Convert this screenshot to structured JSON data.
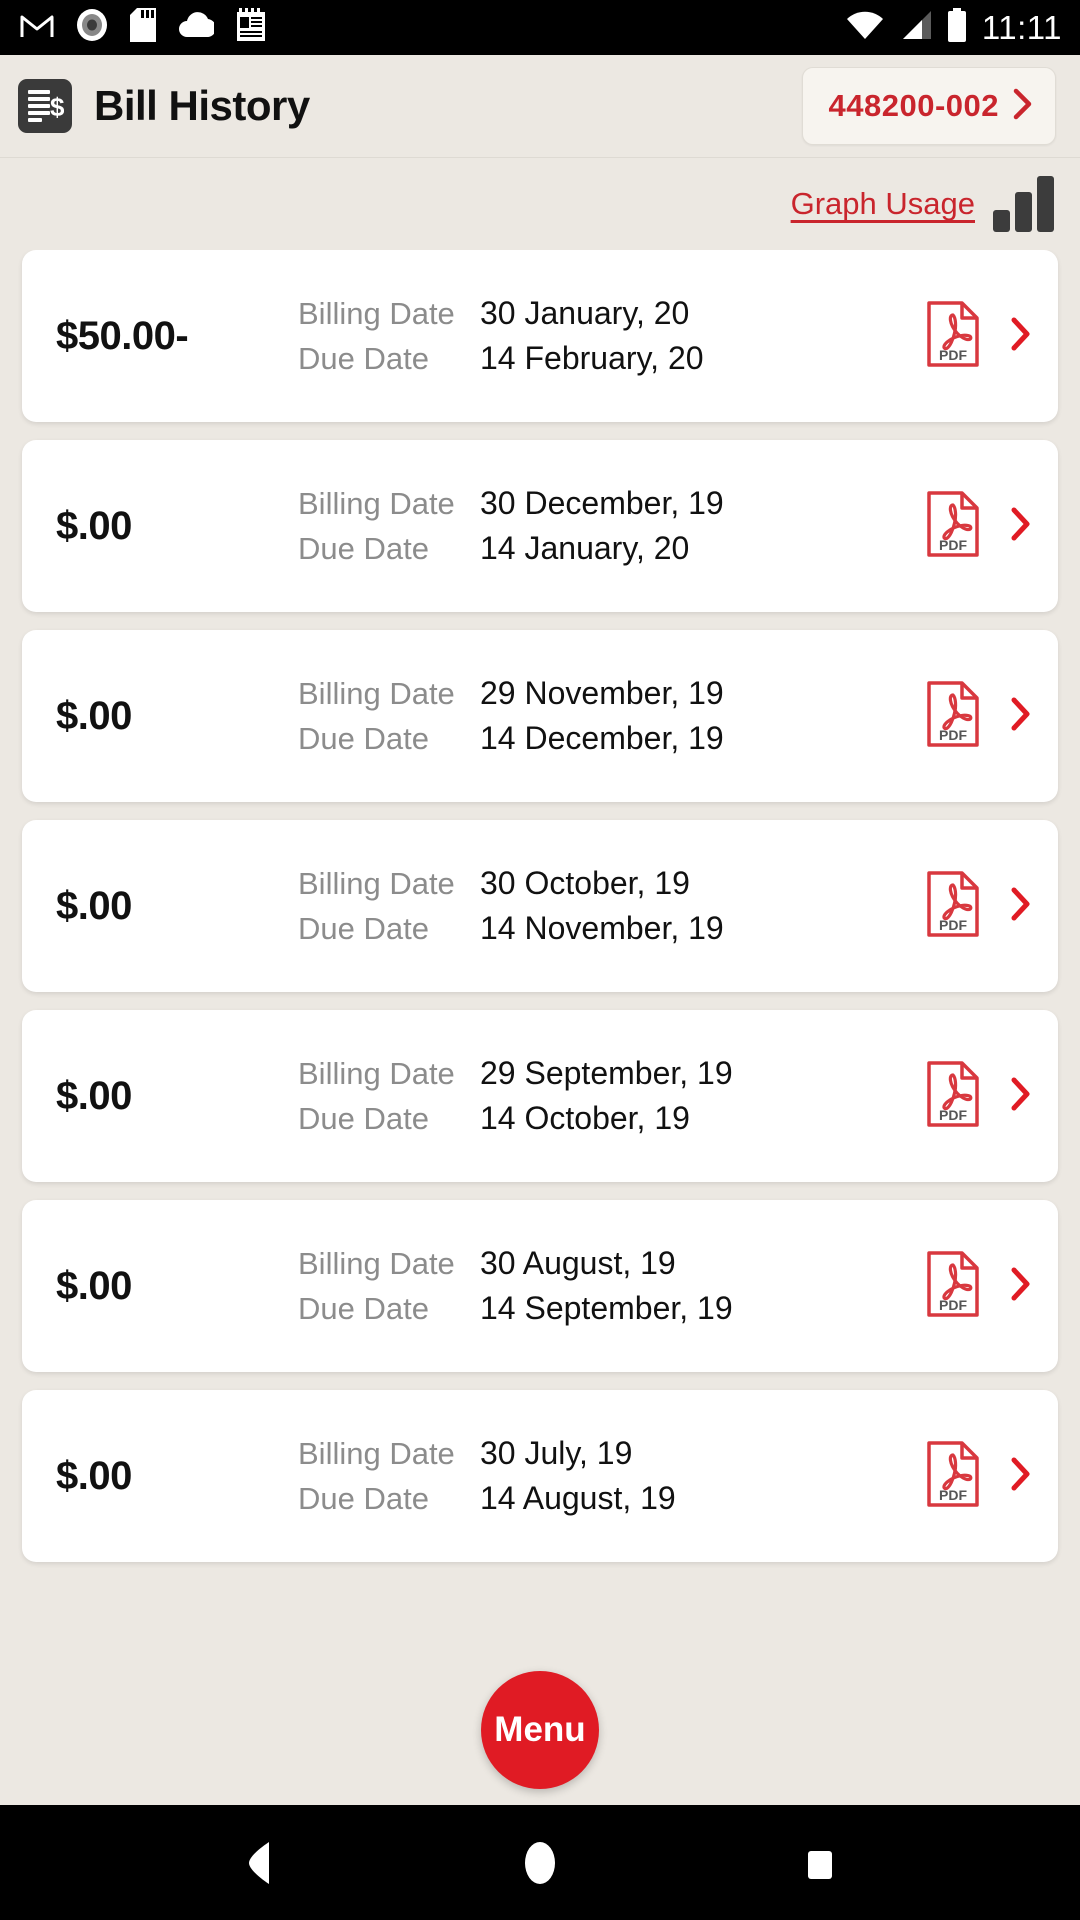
{
  "status_bar": {
    "time": "11:11",
    "left_icons": [
      "gmail-icon",
      "record-icon",
      "sd-card-icon",
      "cloud-icon",
      "notes-icon"
    ],
    "right_icons": [
      "wifi-icon",
      "cellular-signal-icon",
      "battery-icon"
    ]
  },
  "header": {
    "app_icon": "bill-document-icon",
    "title": "Bill History",
    "account": {
      "number": "448200-002",
      "chevron": "chevron-right-icon"
    }
  },
  "usage": {
    "link_label": "Graph Usage",
    "icon": "bar-chart-icon"
  },
  "labels": {
    "billing_date": "Billing Date",
    "due_date": "Due Date",
    "pdf_icon": "pdf-file-icon",
    "pdf_text": "PDF",
    "row_chevron": "chevron-right-icon"
  },
  "bills": [
    {
      "amount": "$50.00-",
      "billing_date": "30 January, 20",
      "due_date": "14 February, 20"
    },
    {
      "amount": "$.00",
      "billing_date": "30 December, 19",
      "due_date": "14 January, 20"
    },
    {
      "amount": "$.00",
      "billing_date": "29 November, 19",
      "due_date": "14 December, 19"
    },
    {
      "amount": "$.00",
      "billing_date": "30 October, 19",
      "due_date": "14 November, 19"
    },
    {
      "amount": "$.00",
      "billing_date": "29 September, 19",
      "due_date": "14 October, 19"
    },
    {
      "amount": "$.00",
      "billing_date": "30 August, 19",
      "due_date": "14 September, 19"
    },
    {
      "amount": "$.00",
      "billing_date": "30 July, 19",
      "due_date": "14 August, 19"
    }
  ],
  "fab": {
    "label": "Menu"
  },
  "nav_bar": {
    "back": "back-triangle-icon",
    "home": "home-circle-icon",
    "recents": "recents-square-icon"
  },
  "colors": {
    "brand_red": "#c9252d",
    "fab_red": "#e01b24",
    "background": "#ece8e2",
    "card": "#ffffff",
    "label_gray": "#8c8c8c",
    "dark": "#3a3a3a"
  }
}
